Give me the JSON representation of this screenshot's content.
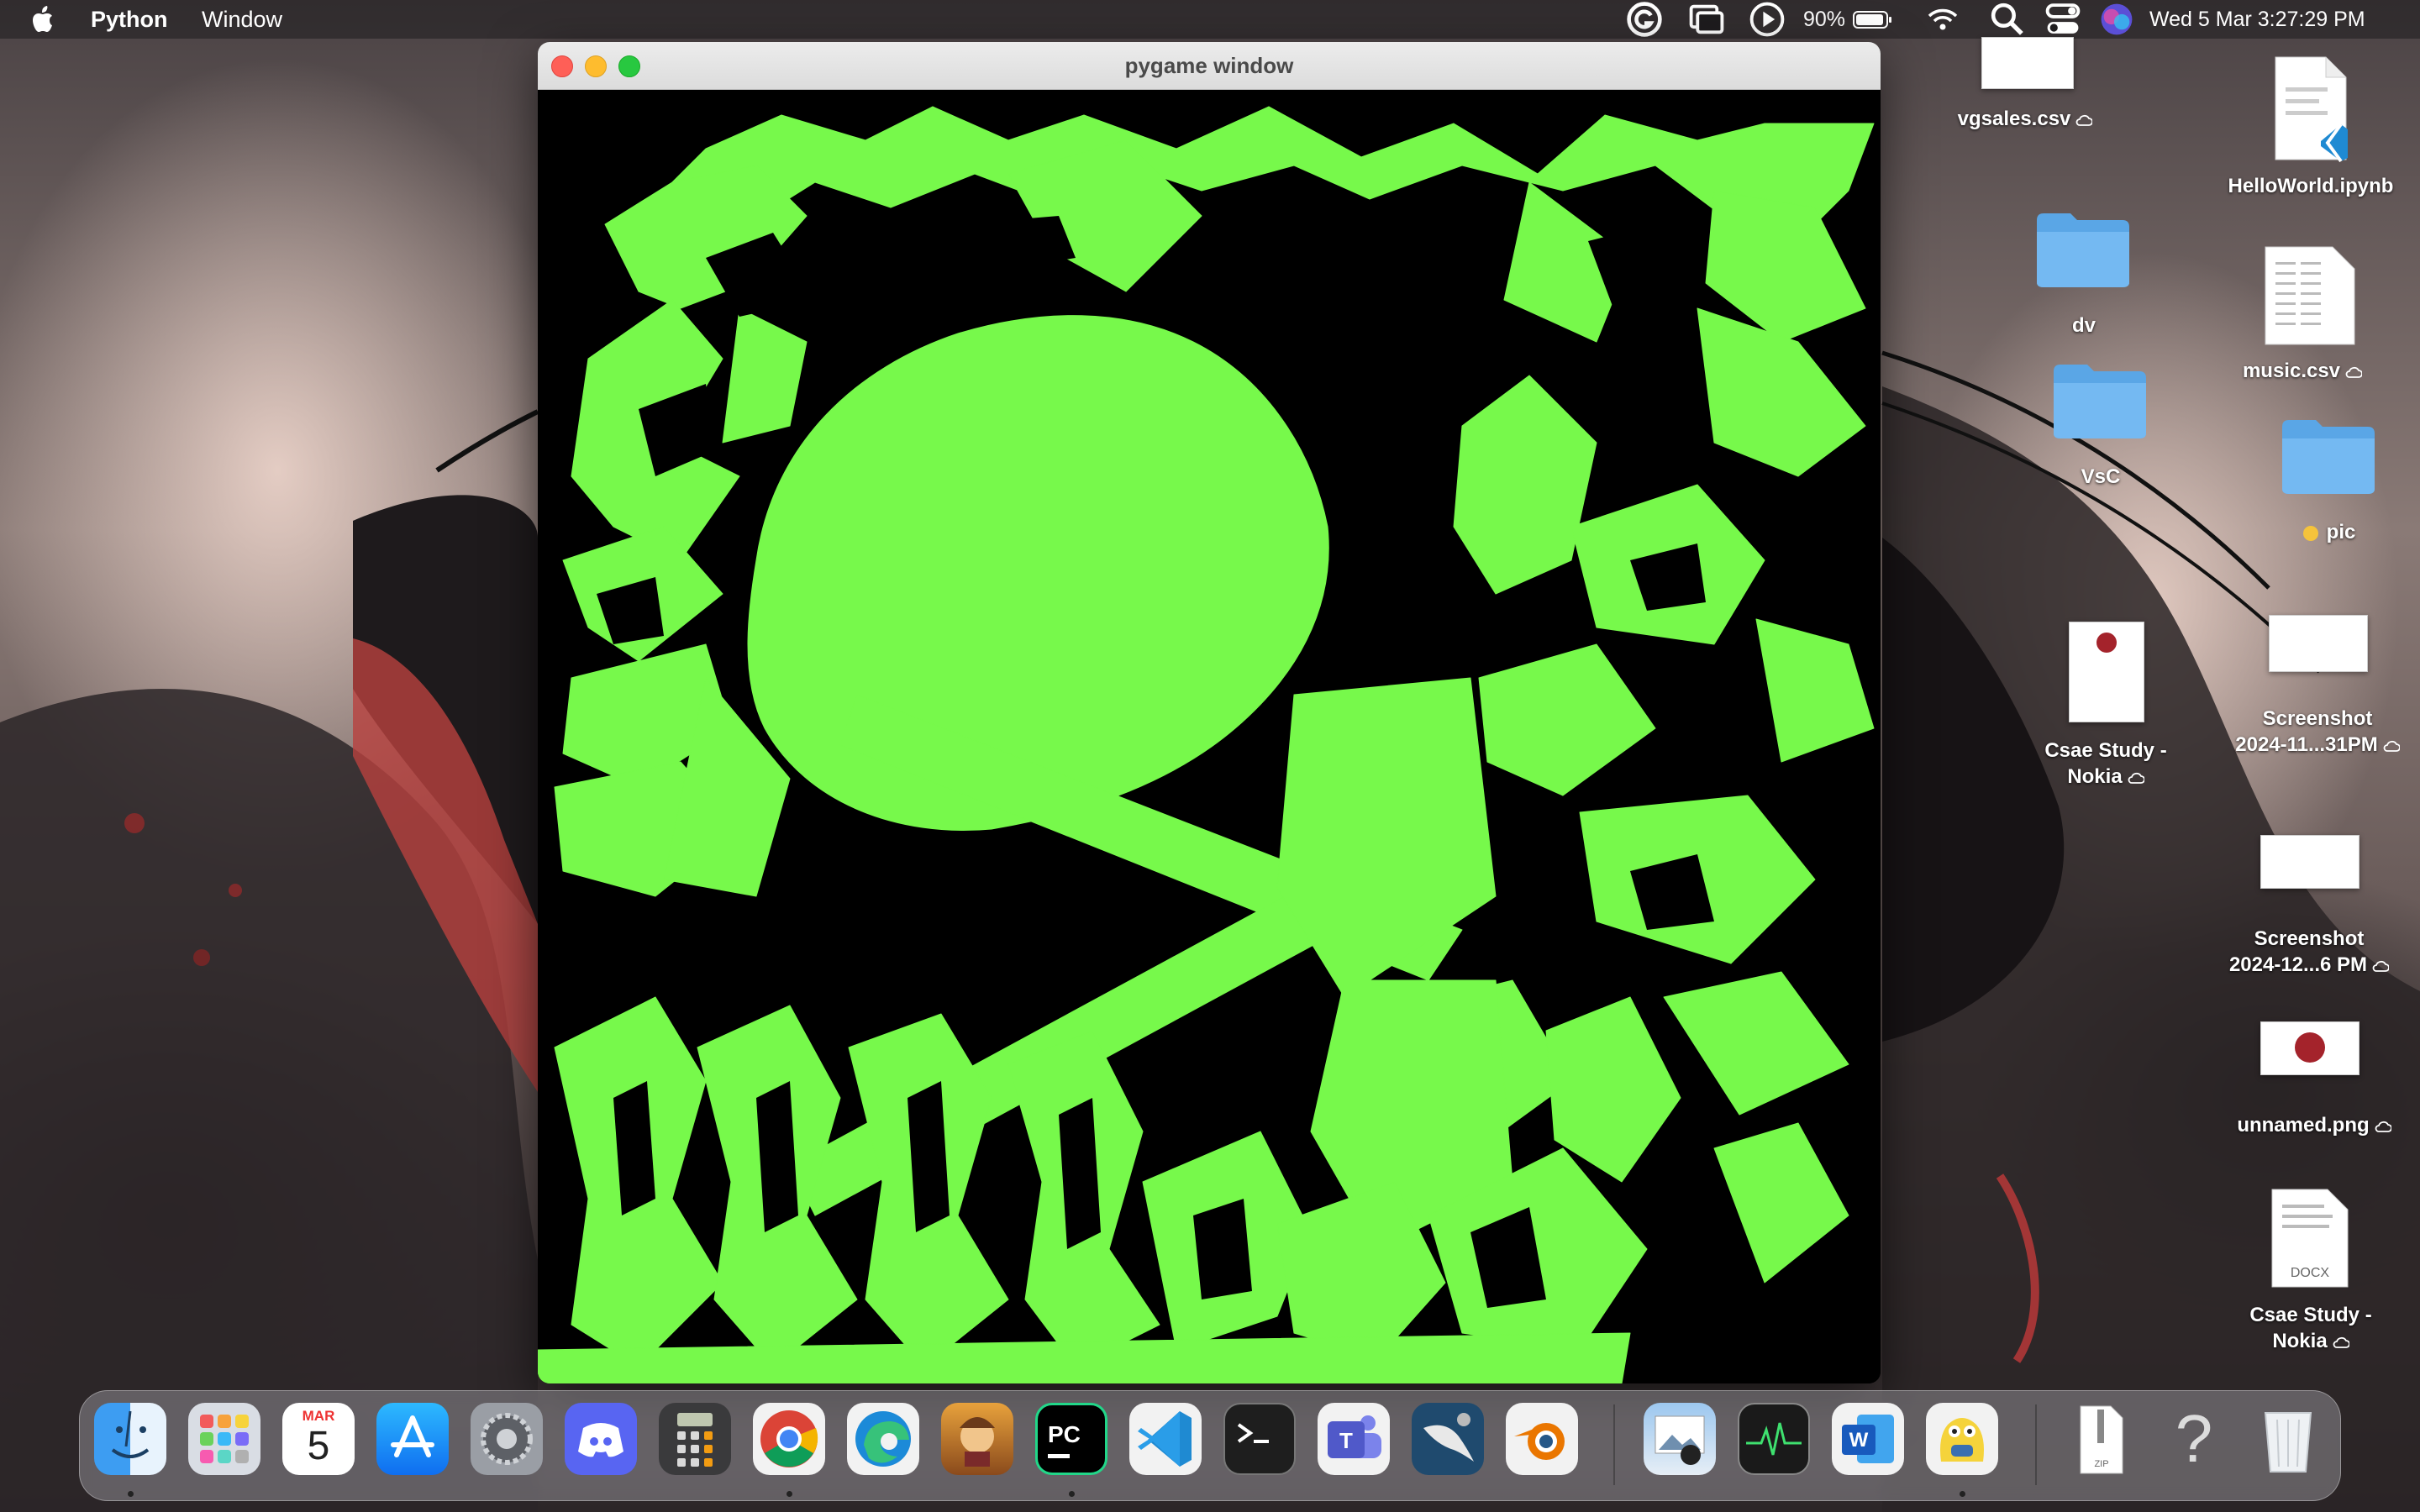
{
  "menubar": {
    "app_name": "Python",
    "menu_items": [
      "Window"
    ],
    "battery": "90%",
    "datetime": "Wed 5 Mar  3:27:29 PM"
  },
  "window": {
    "title": "pygame window",
    "canvas_color": "#000000",
    "drawing_color": "#77f94b"
  },
  "desktop": {
    "files": [
      {
        "name": "vgsales.csv",
        "icon": "csv-file-icon",
        "icloud": true
      },
      {
        "name": "HelloWorld.ipynb",
        "icon": "notebook-file-icon",
        "icloud": false
      },
      {
        "name": "dv",
        "icon": "folder-icon",
        "icloud": false
      },
      {
        "name": "music.csv",
        "icon": "csv-file-icon",
        "icloud": true
      },
      {
        "name": "VsC",
        "icon": "folder-icon",
        "icloud": false
      },
      {
        "name": "pic",
        "icon": "folder-icon",
        "icloud": false,
        "tag_color": "#f5c33b"
      },
      {
        "name_line1": "Csae Study -",
        "name_line2": "Nokia",
        "icon": "pdf-file-icon",
        "icloud": true
      },
      {
        "name_line1": "Screenshot",
        "name_line2": "2024-11...31PM",
        "icon": "screenshot-icon",
        "icloud": true
      },
      {
        "name_line1": "Screenshot",
        "name_line2": "2024-12...6 PM",
        "icon": "screenshot-icon",
        "icloud": true
      },
      {
        "name": "unnamed.png",
        "icon": "image-file-icon",
        "icloud": true
      },
      {
        "name_line1": "Csae Study -",
        "name_line2": "Nokia",
        "icon": "docx-file-icon",
        "badge": "DOCX",
        "icloud": true
      }
    ]
  },
  "dock": {
    "calendar": {
      "month": "MAR",
      "day": "5"
    },
    "apps": [
      "Finder",
      "Launchpad",
      "Calendar",
      "App Store",
      "System Settings",
      "Discord",
      "Calculator",
      "Chrome",
      "Edge",
      "Rise of Kingdoms",
      "PyCharm",
      "VS Code",
      "Terminal",
      "Teams",
      "MySQL Workbench",
      "Blender",
      "Preview",
      "Activity Monitor",
      "Word",
      "Python Launcher",
      "Archive",
      "Help",
      "Trash"
    ],
    "zip_label": "ZIP"
  }
}
